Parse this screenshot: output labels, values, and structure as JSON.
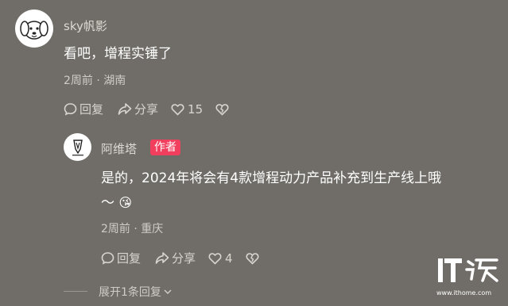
{
  "comment": {
    "username": "sky帆影",
    "text": "看吧，增程实锤了",
    "time": "2周前",
    "location": "湖南",
    "reply_label": "回复",
    "share_label": "分享",
    "like_count": "15"
  },
  "reply": {
    "username": "阿维塔",
    "badge": "作者",
    "text_line1": "是的，2024年将会有4款增程动力产品补充到生产线上哦",
    "text_line2": "～",
    "emoji": "😘",
    "time": "2周前",
    "location": "重庆",
    "reply_label": "回复",
    "share_label": "分享",
    "like_count": "4"
  },
  "expand_label": "展开1条回复",
  "watermark": {
    "logo": "IT之家",
    "url": "www.ithome.com"
  },
  "colors": {
    "background": "#706d68",
    "badge": "#f23f5e"
  }
}
